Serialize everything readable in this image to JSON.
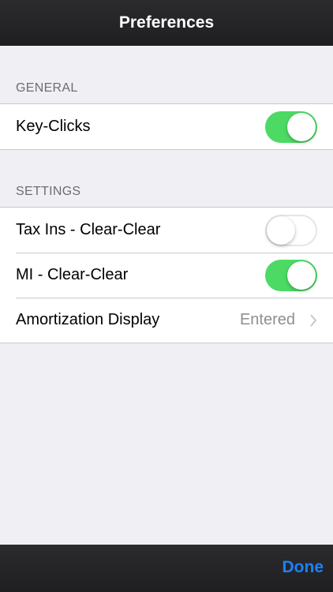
{
  "navbar": {
    "title": "Preferences"
  },
  "sections": {
    "general": {
      "header": "GENERAL",
      "key_clicks": {
        "label": "Key-Clicks",
        "state": "on"
      }
    },
    "settings": {
      "header": "SETTINGS",
      "tax_ins": {
        "label": "Tax Ins - Clear-Clear",
        "state": "off"
      },
      "mi": {
        "label": "MI - Clear-Clear",
        "state": "on"
      },
      "amortization": {
        "label": "Amortization Display",
        "value": "Entered",
        "icon": "chevron-right-icon"
      }
    }
  },
  "toolbar": {
    "done_label": "Done"
  },
  "colors": {
    "switch_on": "#4cd964",
    "accent": "#1a82fb",
    "background": "#efeff4",
    "bar": "#1f1f21"
  }
}
